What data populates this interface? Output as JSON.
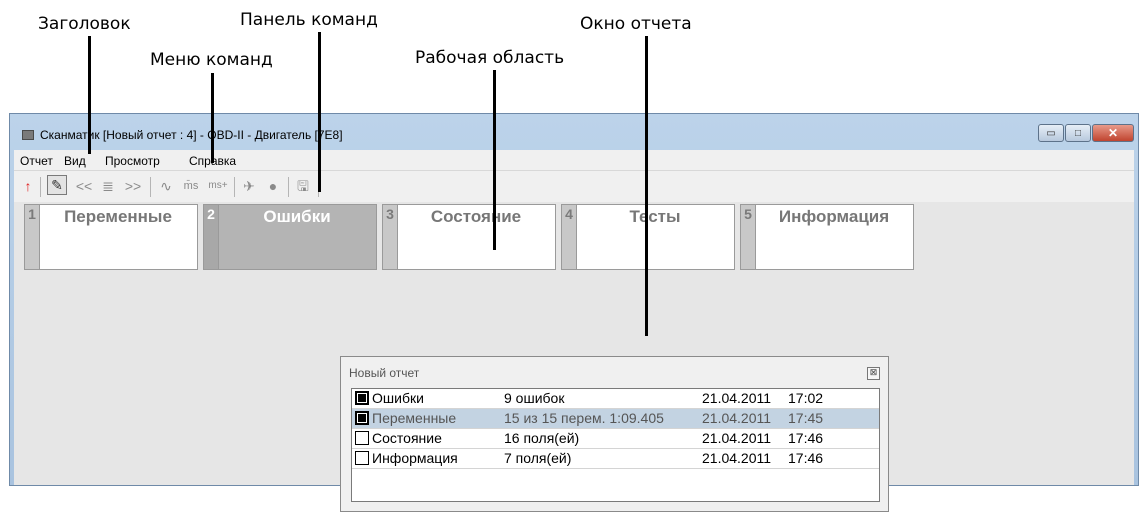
{
  "annotations": {
    "title": "Заголовок",
    "toolbar": "Панель команд",
    "report_window": "Окно отчета",
    "menu": "Меню команд",
    "workspace": "Рабочая область"
  },
  "window": {
    "title": "Сканматик [Новый отчет : 4] - OBD-II - Двигатель [7E8]",
    "close_glyph": "✕",
    "minimize_glyph": "▭",
    "maximize_glyph": "□"
  },
  "menu": [
    "Отчет",
    "Вид",
    "Просмотр",
    "Справка"
  ],
  "toolbar": {
    "back": "↑",
    "prev": "<<",
    "list": "≣",
    "next": ">>",
    "wave": "∿",
    "ms_minus": "m̄s",
    "ms_plus": "ms+",
    "plane": "✈",
    "record": "●",
    "save": "🖫"
  },
  "tabs": [
    {
      "num": "1",
      "label": "Переменные",
      "active": false
    },
    {
      "num": "2",
      "label": "Ошибки",
      "active": true
    },
    {
      "num": "3",
      "label": "Состояние",
      "active": false
    },
    {
      "num": "4",
      "label": "Тесты",
      "active": false
    },
    {
      "num": "5",
      "label": "Информация",
      "active": false
    }
  ],
  "report": {
    "title": "Новый отчет",
    "close_glyph": "⊠",
    "rows": [
      {
        "name": "Ошибки",
        "info": "9 ошибок",
        "date": "21.04.2011",
        "time": "17:02",
        "checked": true,
        "selected": false
      },
      {
        "name": "Переменные",
        "info": "15 из 15 перем. 1:09.405",
        "date": "21.04.2011",
        "time": "17:45",
        "checked": true,
        "selected": true
      },
      {
        "name": "Состояние",
        "info": "16 поля(ей)",
        "date": "21.04.2011",
        "time": "17:46",
        "checked": false,
        "selected": false
      },
      {
        "name": "Информация",
        "info": "7 поля(ей)",
        "date": "21.04.2011",
        "time": "17:46",
        "checked": false,
        "selected": false
      }
    ]
  }
}
